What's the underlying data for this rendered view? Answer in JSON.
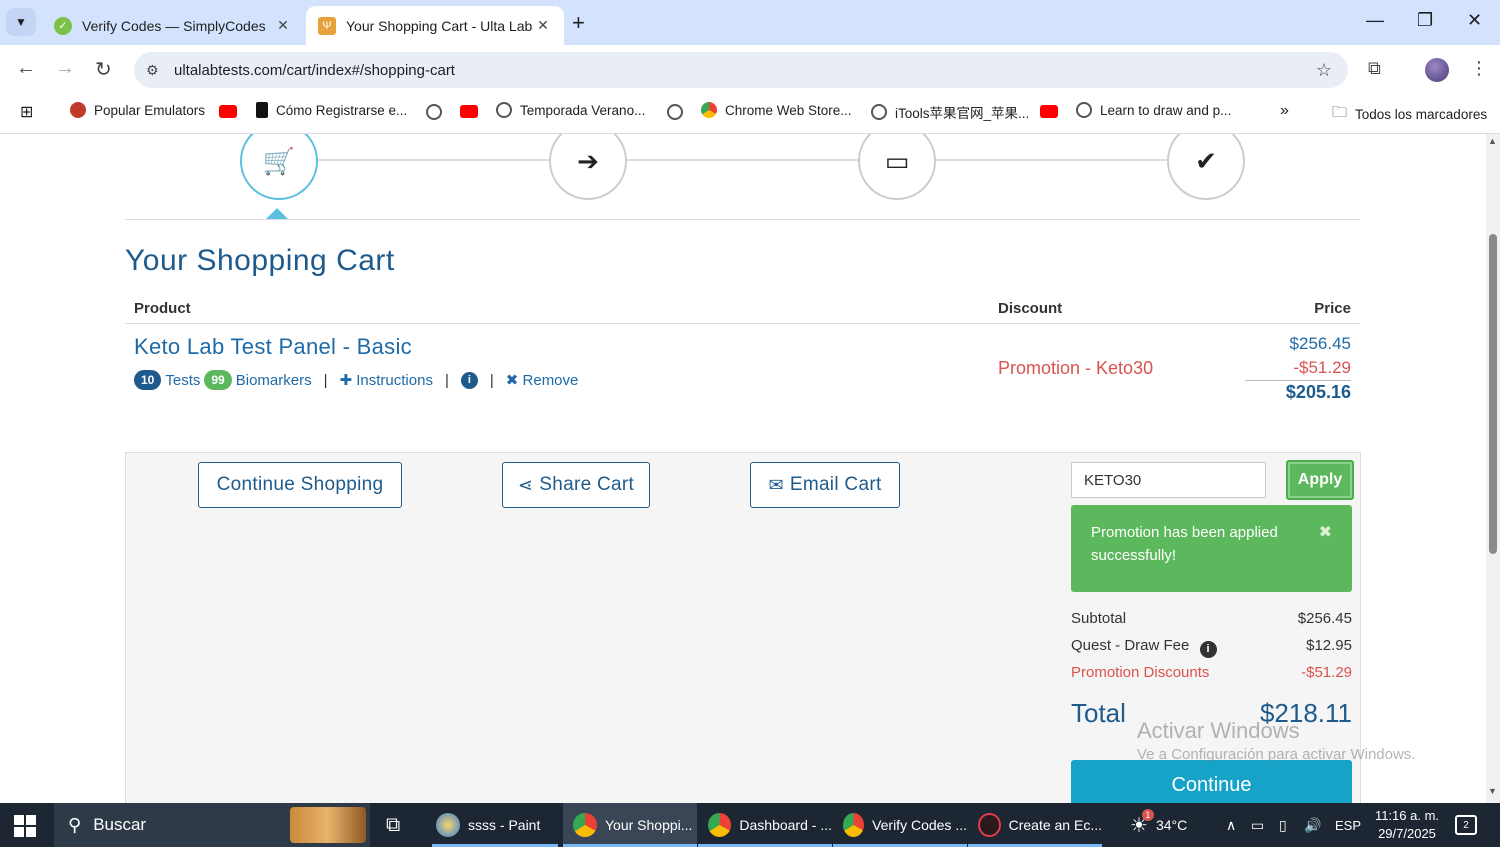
{
  "browser": {
    "tabs": [
      {
        "title": "Verify Codes — SimplyCodes",
        "active": false
      },
      {
        "title": "Your Shopping Cart - Ulta Lab T",
        "active": true
      }
    ],
    "url": "ultalabtests.com/cart/index#/shopping-cart",
    "bookmarks": [
      {
        "label": "Popular Emulators"
      },
      {
        "label": "Cómo Registrarse e..."
      },
      {
        "label": "Temporada Verano..."
      },
      {
        "label": "Chrome Web Store..."
      },
      {
        "label": "iTools苹果官网_苹果..."
      },
      {
        "label": "Learn to draw and p..."
      }
    ],
    "bookmarks_more": "»",
    "all_bookmarks": "Todos los marcadores"
  },
  "cart": {
    "title": "Your Shopping Cart",
    "headers": {
      "product": "Product",
      "discount": "Discount",
      "price": "Price"
    },
    "item": {
      "name": "Keto Lab Test Panel - Basic",
      "tests_count": "10",
      "tests_label": "Tests",
      "biomarkers_count": "99",
      "biomarkers_label": "Biomarkers",
      "instructions_label": "Instructions",
      "remove_label": "Remove",
      "promotion": "Promotion - Keto30",
      "price_original": "$256.45",
      "price_discount": "-$51.29",
      "price_final": "$205.16"
    },
    "actions": {
      "continue_shopping": "Continue Shopping",
      "share_cart": "Share Cart",
      "email_cart": "Email Cart"
    },
    "promo": {
      "code_value": "KETO30",
      "apply_label": "Apply",
      "success_message": "Promotion has been applied successfully!"
    },
    "summary": {
      "subtotal_label": "Subtotal",
      "subtotal_value": "$256.45",
      "draw_fee_label": "Quest - Draw Fee",
      "draw_fee_value": "$12.95",
      "promo_label": "Promotion Discounts",
      "promo_value": "-$51.29",
      "total_label": "Total",
      "total_value": "$218.11",
      "continue_label": "Continue"
    }
  },
  "watermark": {
    "line1": "Activar Windows",
    "line2": "Ve a Configuración para activar Windows."
  },
  "taskbar": {
    "search_placeholder": "Buscar",
    "items": [
      {
        "label": "ssss - Paint"
      },
      {
        "label": "Your Shoppi..."
      },
      {
        "label": "Dashboard - ..."
      },
      {
        "label": "Verify Codes ..."
      },
      {
        "label": "Create an Ec..."
      }
    ],
    "weather_badge": "1",
    "temperature": "34°C",
    "language": "ESP",
    "time": "11:16 a. m.",
    "date": "29/7/2025",
    "notification_count": "2"
  },
  "colors": {
    "brand_blue": "#1e5b8c",
    "link_blue": "#1e6aa8",
    "promo_red": "#d9534f",
    "success_green": "#5cb85c",
    "continue_teal": "#17a2c8",
    "step_active": "#5bc0de"
  }
}
